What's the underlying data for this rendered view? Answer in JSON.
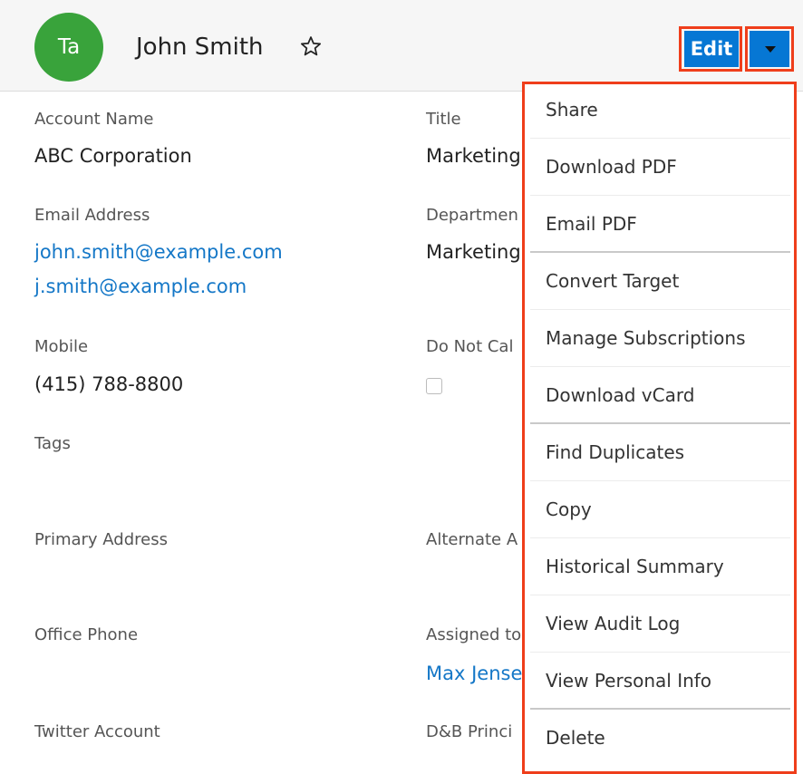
{
  "header": {
    "avatar_initials": "Ta",
    "record_name": "John Smith",
    "edit_label": "Edit"
  },
  "fields": {
    "account_name": {
      "label": "Account Name",
      "value": "ABC Corporation"
    },
    "title": {
      "label": "Title",
      "value": "Marketing"
    },
    "email": {
      "label": "Email Address",
      "values": [
        "john.smith@example.com",
        "j.smith@example.com"
      ]
    },
    "department": {
      "label": "Departmen",
      "value": "Marketing"
    },
    "mobile": {
      "label": "Mobile",
      "value": "(415) 788-8800"
    },
    "do_not_call": {
      "label": "Do Not Cal",
      "checked": false
    },
    "tags": {
      "label": "Tags"
    },
    "primary_address": {
      "label": "Primary Address"
    },
    "alternate_address": {
      "label": "Alternate A"
    },
    "office_phone": {
      "label": "Office Phone"
    },
    "assigned_to": {
      "label": "Assigned to",
      "value": "Max Jense"
    },
    "twitter": {
      "label": "Twitter Account"
    },
    "dnb": {
      "label": "D&B Princi"
    }
  },
  "menu": {
    "items": [
      {
        "label": "Share"
      },
      {
        "label": "Download PDF"
      },
      {
        "label": "Email PDF"
      },
      {
        "label": "Convert Target"
      },
      {
        "label": "Manage Subscriptions"
      },
      {
        "label": "Download vCard"
      },
      {
        "label": "Find Duplicates"
      },
      {
        "label": "Copy"
      },
      {
        "label": "Historical Summary"
      },
      {
        "label": "View Audit Log"
      },
      {
        "label": "View Personal Info"
      },
      {
        "label": "Delete"
      }
    ]
  },
  "colors": {
    "accent": "#0677d4",
    "highlight": "#ef3e1b",
    "avatar": "#39a33b",
    "link": "#1477c7"
  },
  "icons": {
    "favorite": "star-outline-icon",
    "actions": "caret-down-icon"
  }
}
